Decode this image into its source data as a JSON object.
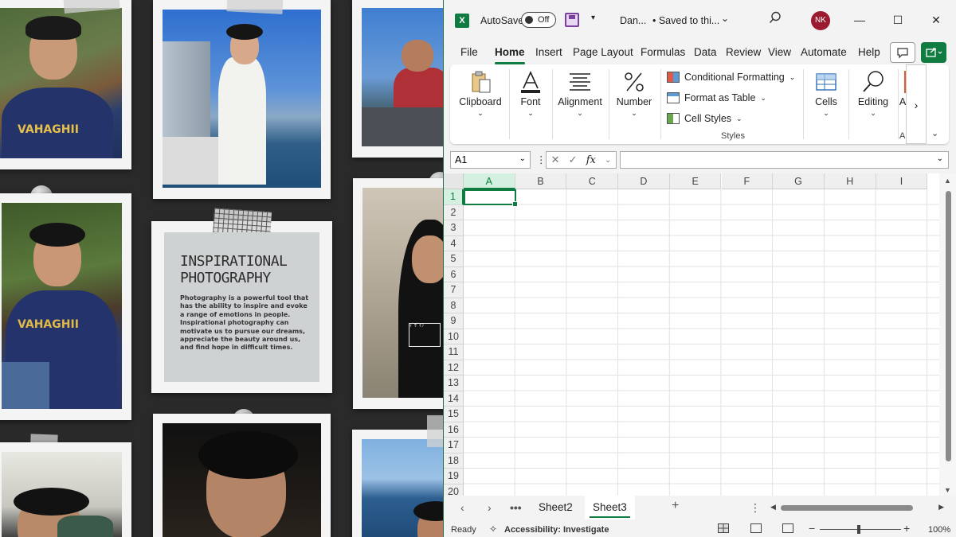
{
  "wallpaper": {
    "note_title": "INSPIRATIONAL PHOTOGRAPHY",
    "note_body": "Photography is a powerful tool that has the ability to inspire and evoke a range of emotions in people. Inspirational photography can motivate us to pursue our dreams, appreciate the beauty around us, and find hope in difficult times.",
    "shirt_text": "VAHAGHII"
  },
  "titlebar": {
    "autosave_label": "AutoSave",
    "autosave_state": "Off",
    "doc_name": "Dan...",
    "saved_status": "• Saved to thi...",
    "avatar_initials": "NK",
    "minimize": "—",
    "maximize": "☐",
    "close": "✕"
  },
  "tabs": [
    "File",
    "Home",
    "Insert",
    "Page Layout",
    "Formulas",
    "Data",
    "Review",
    "View",
    "Automate",
    "Help"
  ],
  "active_tab": "Home",
  "ribbon": {
    "clipboard": "Clipboard",
    "font": "Font",
    "alignment": "Alignment",
    "number": "Number",
    "conditional_formatting": "Conditional Formatting",
    "format_as_table": "Format as Table",
    "cell_styles": "Cell Styles",
    "styles_group": "Styles",
    "cells": "Cells",
    "editing": "Editing",
    "truncated": "A",
    "truncated_group": "A"
  },
  "formula_bar": {
    "name_box": "A1",
    "fx": "fx",
    "cancel": "✕",
    "enter": "✓",
    "formula": ""
  },
  "grid": {
    "columns": [
      "A",
      "B",
      "C",
      "D",
      "E",
      "F",
      "G",
      "H",
      "I"
    ],
    "rows": [
      "1",
      "2",
      "3",
      "4",
      "5",
      "6",
      "7",
      "8",
      "9",
      "10",
      "11",
      "12",
      "13",
      "14",
      "15",
      "16",
      "17",
      "18",
      "19",
      "20"
    ],
    "selected_cell": "A1"
  },
  "sheets": [
    "Sheet2",
    "Sheet3"
  ],
  "active_sheet": "Sheet3",
  "statusbar": {
    "ready": "Ready",
    "accessibility": "Accessibility: Investigate",
    "zoom_minus": "−",
    "zoom_plus": "+",
    "zoom": "100%"
  },
  "colors": {
    "excel_green": "#107c41",
    "avatar": "#9b1b30",
    "background": "#2a2a2a"
  }
}
